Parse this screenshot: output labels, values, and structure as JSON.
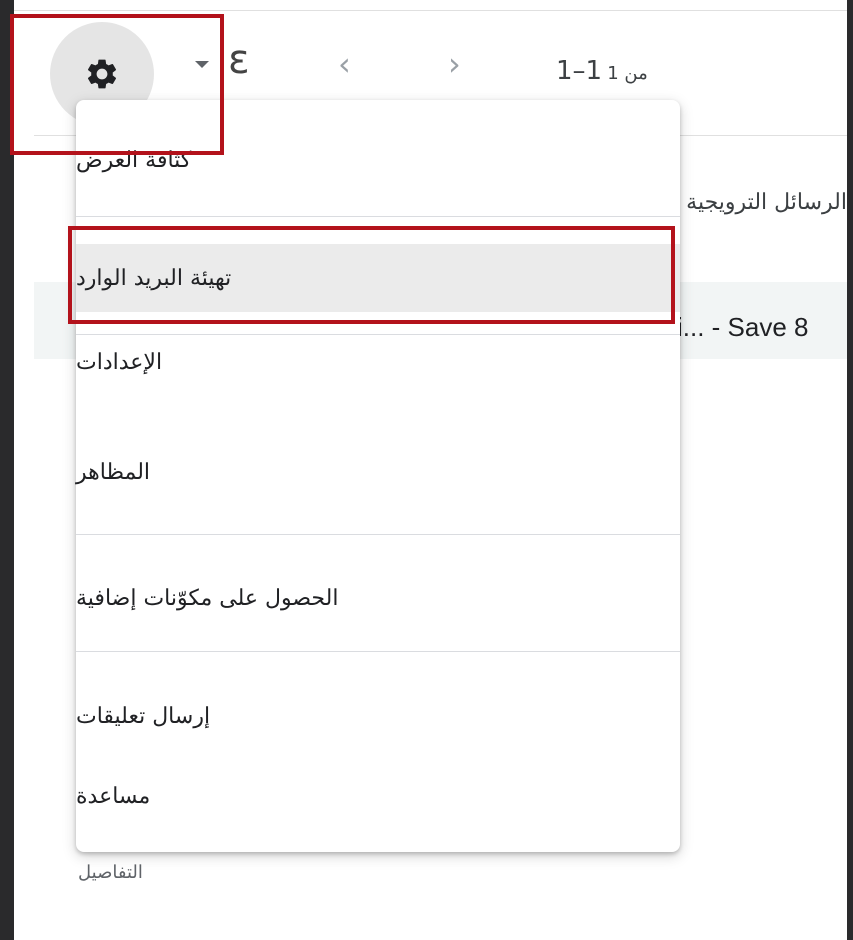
{
  "toolbar": {
    "settings_icon": "gear-icon",
    "dropdown_icon": "caret-down-icon",
    "lang_glyph": "ε",
    "prev_glyph": "‹",
    "next_glyph": "›",
    "pager_count": "1–1",
    "pager_of": "من 1"
  },
  "background": {
    "tab_label": "الرسائل الترويجية",
    "email_snippet": "i... - Save 8",
    "details_link": "التفاصيل"
  },
  "menu": {
    "display_density": "كثافة العرض",
    "configure_inbox": "تهيئة البريد الوارد",
    "settings": "الإعدادات",
    "themes": "المظاهر",
    "get_addons": "الحصول على مكوّنات إضافية",
    "send_feedback": "إرسال تعليقات",
    "help": "مساعدة"
  },
  "colors": {
    "highlight": "#b3121b",
    "active_row": "#ebebeb",
    "settings_button_bg": "#e5e5e5"
  }
}
